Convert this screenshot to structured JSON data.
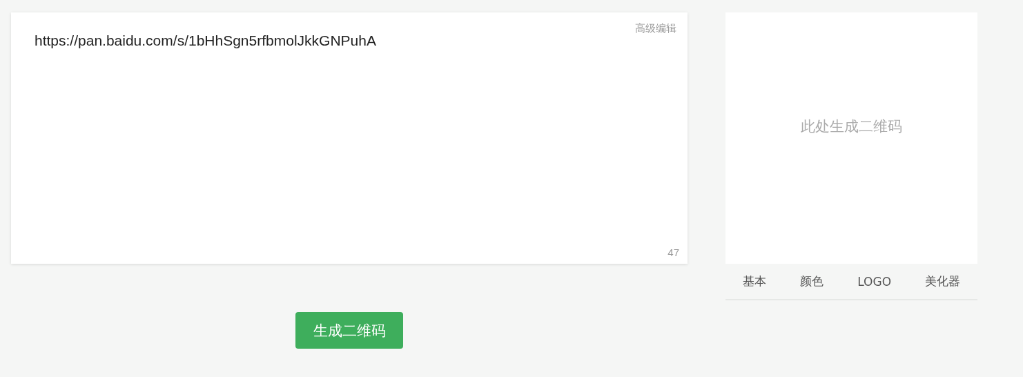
{
  "editor": {
    "value": "https://pan.baidu.com/s/1bHhSgn5rfbmolJkkGNPuhA",
    "advanced_link": "高级编辑",
    "char_count": "47"
  },
  "preview": {
    "message": "此处生成二维码"
  },
  "tabs": [
    {
      "label": "基本"
    },
    {
      "label": "颜色"
    },
    {
      "label": "LOGO"
    },
    {
      "label": "美化器"
    }
  ],
  "generate_button": "生成二维码"
}
